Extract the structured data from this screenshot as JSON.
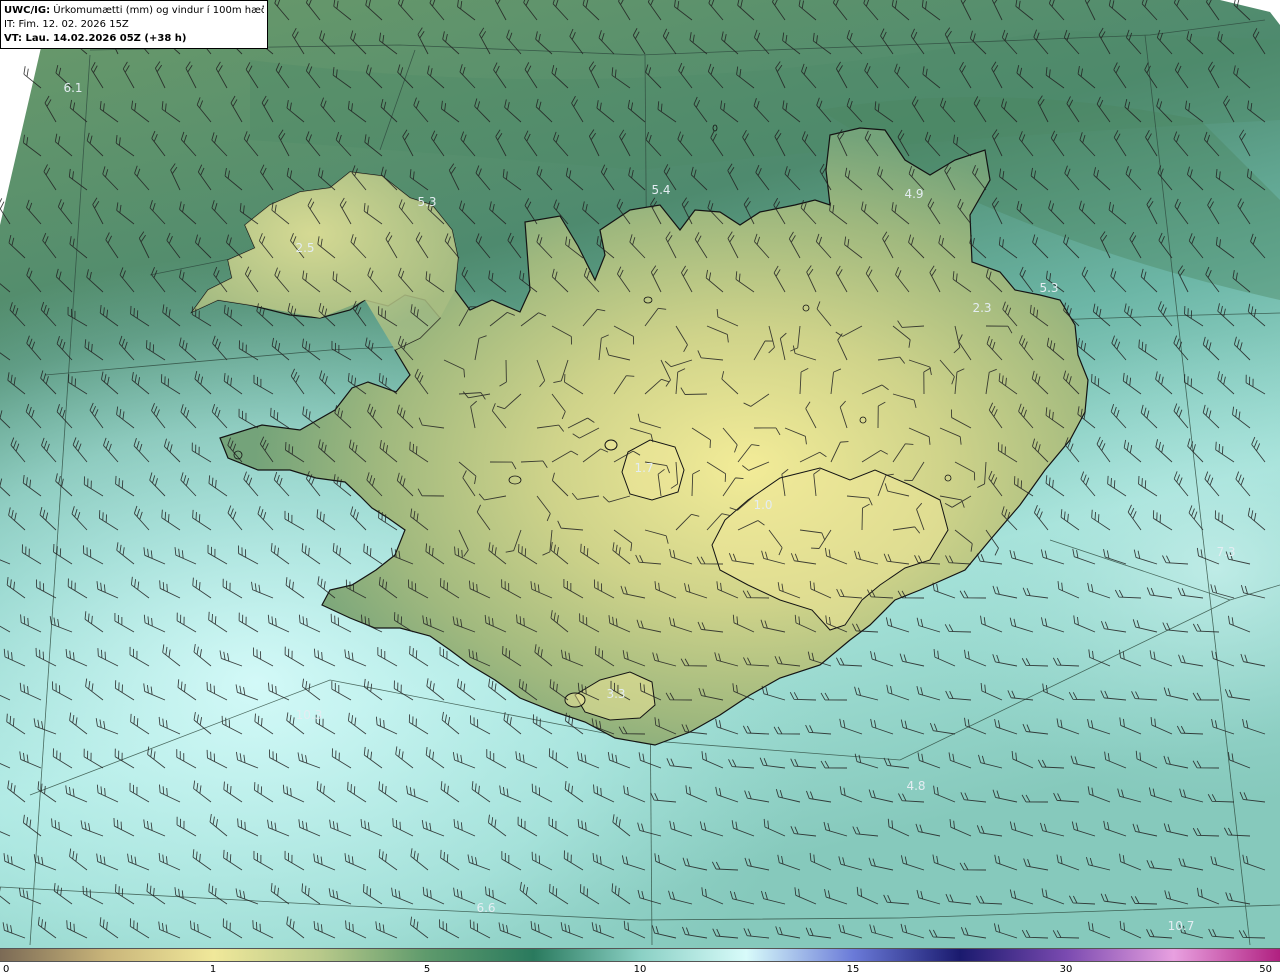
{
  "header": {
    "model_label": "UWC/IG:",
    "title": "Úrkomumætti (mm) og vindur í 100m hæð",
    "issue_time": "IT: Fim. 12. 02. 2026 15Z",
    "valid_time": "VT: Lau. 14.02.2026 05Z (+38 h)"
  },
  "map_values": [
    {
      "name": "value-nw-sea",
      "text": "6.1"
    },
    {
      "name": "value-westfjords",
      "text": "5.3"
    },
    {
      "name": "value-westfjords-inland",
      "text": "2.5"
    },
    {
      "name": "value-north-coast",
      "text": "5.4"
    },
    {
      "name": "value-northeast",
      "text": "4.9"
    },
    {
      "name": "value-east-coast",
      "text": "5.3"
    },
    {
      "name": "value-east-inland",
      "text": "2.3"
    },
    {
      "name": "value-langjokull",
      "text": "1.7"
    },
    {
      "name": "value-vatnajokull",
      "text": "1.0"
    },
    {
      "name": "value-east-sea",
      "text": "7.3"
    },
    {
      "name": "value-myrdalsjokull",
      "text": "3.3"
    },
    {
      "name": "value-sw-sea",
      "text": "10.3"
    },
    {
      "name": "value-south-sea",
      "text": "4.8"
    },
    {
      "name": "value-south-far-sea",
      "text": "6.6"
    },
    {
      "name": "value-se-far-sea",
      "text": "10.7"
    }
  ],
  "colorbar": {
    "ticks": [
      "0",
      "1",
      "5",
      "10",
      "15",
      "30",
      "50"
    ],
    "stops": [
      {
        "color": "#7b6a55"
      },
      {
        "color": "#c9b57a"
      },
      {
        "color": "#f0e89a"
      },
      {
        "color": "#b8c98a"
      },
      {
        "color": "#5e9a6c"
      },
      {
        "color": "#2a7a5e"
      },
      {
        "color": "#8ad0c4"
      },
      {
        "color": "#d8fbfa"
      },
      {
        "color": "#6a7ad8"
      },
      {
        "color": "#1a1a6e"
      },
      {
        "color": "#7a4ab0"
      },
      {
        "color": "#e8a0e0"
      },
      {
        "color": "#b02080"
      }
    ]
  },
  "colors": {
    "land_high": "#e8e394",
    "land_mid": "#a6b97c",
    "land_low": "#6ea07a",
    "sea_north": "#6c9a6e",
    "sea_south": "#a7e0da",
    "sea_far_south": "#c9f3f0",
    "coastline": "#1a1a1a"
  }
}
